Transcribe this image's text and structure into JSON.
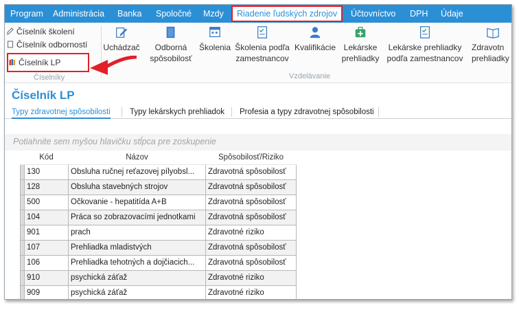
{
  "menu": {
    "items": [
      "Program",
      "Administrácia",
      "Banka",
      "Spoločné",
      "Mzdy",
      "Riadenie ľudských zdrojov",
      "Účtovníctvo",
      "DPH",
      "Údaje"
    ],
    "active": "Riadenie ľudských zdrojov"
  },
  "ribbon": {
    "ciselniky": {
      "items": [
        "Číselník školení",
        "Číselník odborností",
        "Číselník LP"
      ],
      "group_label": "Číselníky"
    },
    "vzdelavanie": {
      "group_label": "Vzdelávanie",
      "buttons": [
        {
          "label": "Uchádzač",
          "icon": "pencil-icon"
        },
        {
          "label": "Odborná spôsobilosť",
          "line1": "Odborná",
          "line2": "spôsobilosť",
          "icon": "book-icon"
        },
        {
          "label": "Školenia",
          "icon": "calendar-icon"
        },
        {
          "label": "Školenia podľa zamestnancov",
          "line1": "Školenia podľa",
          "line2": "zamestnancov",
          "icon": "checklist-icon"
        },
        {
          "label": "Kvalifikácie",
          "icon": "user-icon"
        },
        {
          "label": "Lekárske prehliadky",
          "line1": "Lekárske",
          "line2": "prehliadky",
          "icon": "medkit-icon"
        },
        {
          "label": "Lekárske prehliadky podľa zamestnancov",
          "line1": "Lekárske prehliadky",
          "line2": "podľa zamestnancov",
          "icon": "checklist-icon"
        },
        {
          "label": "Zdravotné prehliadky",
          "line1": "Zdravotn",
          "line2": "prehliadky",
          "icon": "book-open-icon"
        }
      ]
    }
  },
  "page": {
    "title": "Číselník LP",
    "tabs": [
      "Typy zdravotnej spôsobilosti",
      "Typy lekárskych prehliadok",
      "Profesia a typy zdravotnej spôsobilosti"
    ],
    "active_tab": "Typy zdravotnej spôsobilosti",
    "group_hint": "Potiahnite sem myšou hlavičku stĺpca pre zoskupenie"
  },
  "grid": {
    "columns": [
      "Kód",
      "Názov",
      "Spôsobilosť/Riziko"
    ],
    "rows": [
      [
        "130",
        "Obsluha ručnej reťazovej pílyobsl...",
        "Zdravotná spôsobilosť"
      ],
      [
        "128",
        "Obsluha stavebných strojov",
        "Zdravotná spôsobilosť"
      ],
      [
        "500",
        "Očkovanie - hepatitída A+B",
        "Zdravotná spôsobilosť"
      ],
      [
        "104",
        "Práca so zobrazovacími jednotkami",
        "Zdravotná spôsobilosť"
      ],
      [
        "901",
        "prach",
        "Zdravotné riziko"
      ],
      [
        "107",
        "Prehliadka mladistvých",
        "Zdravotná spôsobilosť"
      ],
      [
        "106",
        "Prehliadka tehotných a dojčiacich...",
        "Zdravotná spôsobilosť"
      ],
      [
        "910",
        "psychická záťaž",
        "Zdravotné riziko"
      ],
      [
        "909",
        "psychická záťaž",
        "Zdravotné riziko"
      ]
    ]
  },
  "colors": {
    "brand_blue": "#2b8fd6",
    "highlight_red": "#e0202a"
  }
}
